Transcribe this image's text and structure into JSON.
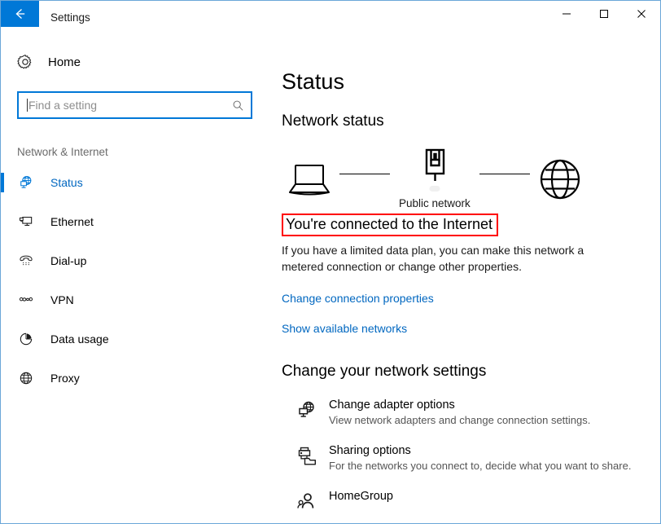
{
  "window": {
    "title": "Settings",
    "back_icon": "back-arrow-icon",
    "controls": {
      "minimize": "minimize-icon",
      "maximize": "maximize-icon",
      "close": "close-icon"
    }
  },
  "sidebar": {
    "home_label": "Home",
    "home_icon": "gear-icon",
    "search": {
      "placeholder": "Find a setting",
      "value": "",
      "icon": "search-icon"
    },
    "section_label": "Network & Internet",
    "items": [
      {
        "label": "Status",
        "icon": "network-status-icon",
        "selected": true
      },
      {
        "label": "Ethernet",
        "icon": "ethernet-icon",
        "selected": false
      },
      {
        "label": "Dial-up",
        "icon": "dialup-phone-icon",
        "selected": false
      },
      {
        "label": "VPN",
        "icon": "vpn-icon",
        "selected": false
      },
      {
        "label": "Data usage",
        "icon": "pie-chart-icon",
        "selected": false
      },
      {
        "label": "Proxy",
        "icon": "globe-icon",
        "selected": false
      }
    ]
  },
  "main": {
    "page_title": "Status",
    "network_status_heading": "Network status",
    "diagram": {
      "device_icon": "laptop-icon",
      "network_icon": "ethernet-port-icon",
      "internet_icon": "globe-icon",
      "network_caption": "Public network"
    },
    "connection_text": "You're connected to the Internet",
    "connection_description": "If you have a limited data plan, you can make this network a metered connection or change other properties.",
    "links": [
      "Change connection properties",
      "Show available networks"
    ],
    "settings_heading": "Change your network settings",
    "settings": [
      {
        "title": "Change adapter options",
        "desc": "View network adapters and change connection settings.",
        "icon": "adapter-globe-monitor-icon"
      },
      {
        "title": "Sharing options",
        "desc": "For the networks you connect to, decide what you want to share.",
        "icon": "printer-folder-icon"
      },
      {
        "title": "HomeGroup",
        "desc": "",
        "icon": "homegroup-people-icon"
      }
    ]
  },
  "colors": {
    "accent": "#0078d7",
    "link": "#0067c0",
    "highlight": "#ff0000",
    "window_border": "#6ba7d8"
  }
}
